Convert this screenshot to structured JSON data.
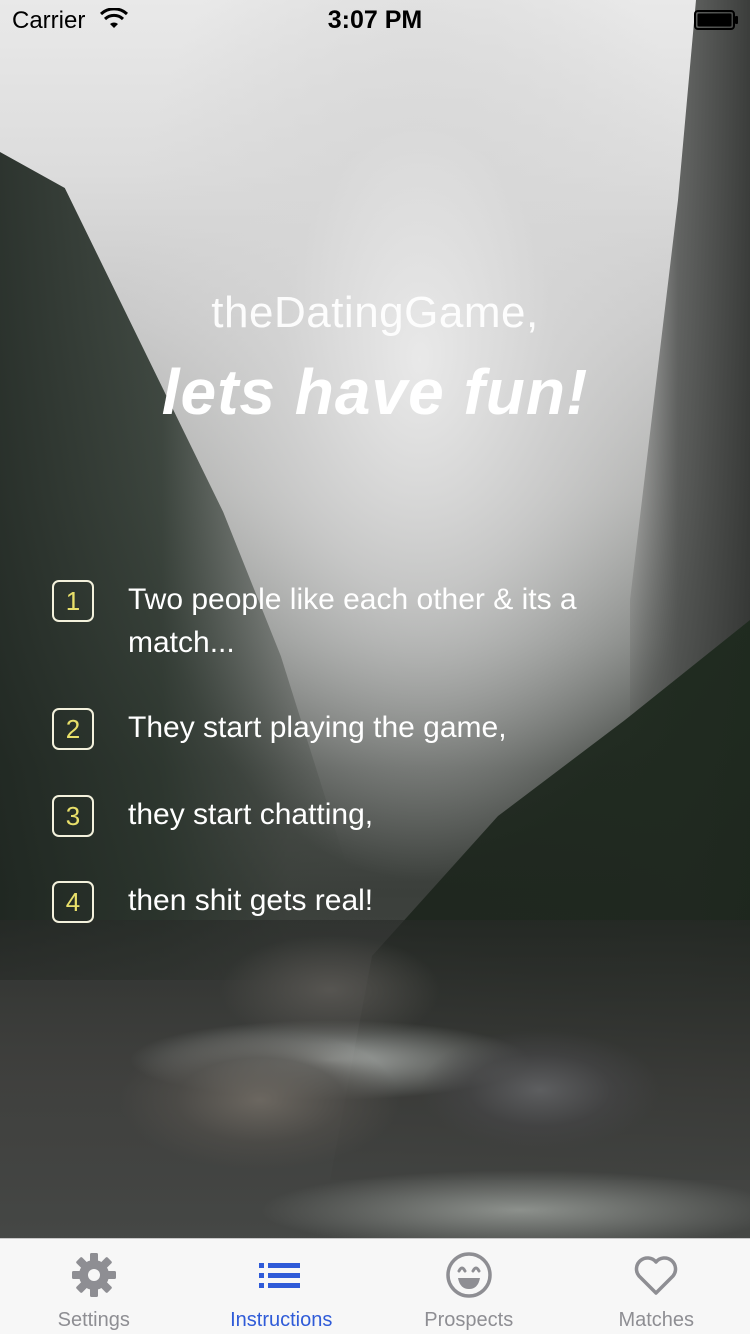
{
  "status_bar": {
    "carrier": "Carrier",
    "time": "3:07 PM"
  },
  "header": {
    "title": "theDatingGame,",
    "subtitle": "lets have fun!"
  },
  "steps": [
    {
      "number": "1",
      "text": "Two people like each other & its a match..."
    },
    {
      "number": "2",
      "text": "They start playing the game,"
    },
    {
      "number": "3",
      "text": "they start chatting,"
    },
    {
      "number": "4",
      "text": "then shit gets real!"
    }
  ],
  "tab_bar": {
    "active": "Instructions",
    "tabs": [
      {
        "label": "Settings",
        "icon": "gear-icon"
      },
      {
        "label": "Instructions",
        "icon": "list-icon"
      },
      {
        "label": "Prospects",
        "icon": "smiley-icon"
      },
      {
        "label": "Matches",
        "icon": "heart-icon"
      }
    ]
  },
  "colors": {
    "accent": "#2f5bd8",
    "inactive_tab": "#8e8e93",
    "step_number": "#e9e06a"
  }
}
